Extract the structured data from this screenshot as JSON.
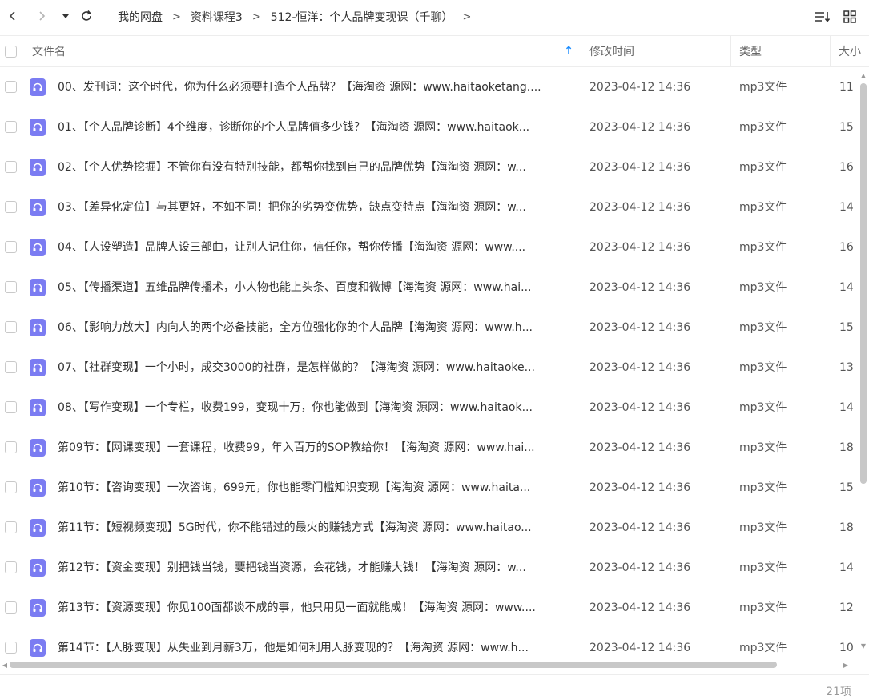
{
  "toolbar": {
    "back_icon": "chevron-left-icon",
    "forward_icon": "chevron-right-icon",
    "history_icon": "caret-down-icon",
    "refresh_icon": "refresh-icon",
    "sort_icon": "sort-icon",
    "view_icon": "grid-view-icon",
    "breadcrumbs": [
      "我的网盘",
      "资料课程3",
      "512-恒洋：个人品牌变现课（千聊）"
    ],
    "breadcrumb_separator": ">"
  },
  "header": {
    "col_name": "文件名",
    "col_modified": "修改时间",
    "col_type": "类型",
    "col_size": "大小",
    "sort_indicator": "↑",
    "sort_color": "#1a8cff"
  },
  "files": [
    {
      "name": "00、发刊词：这个时代，你为什么必须要打造个人品牌？【海淘资 源网：www.haitaoketang....",
      "modified": "2023-04-12 14:36",
      "type": "mp3文件",
      "size": "11"
    },
    {
      "name": "01、【个人品牌诊断】4个维度，诊断你的个人品牌值多少钱？【海淘资 源网：www.haitaok...",
      "modified": "2023-04-12 14:36",
      "type": "mp3文件",
      "size": "15"
    },
    {
      "name": "02、【个人优势挖掘】不管你有没有特别技能，都帮你找到自己的品牌优势【海淘资 源网：w...",
      "modified": "2023-04-12 14:36",
      "type": "mp3文件",
      "size": "16"
    },
    {
      "name": "03、【差异化定位】与其更好，不如不同！把你的劣势变优势，缺点变特点【海淘资 源网：w...",
      "modified": "2023-04-12 14:36",
      "type": "mp3文件",
      "size": "14"
    },
    {
      "name": "04、【人设塑造】品牌人设三部曲，让别人记住你，信任你，帮你传播【海淘资 源网：www....",
      "modified": "2023-04-12 14:36",
      "type": "mp3文件",
      "size": "16"
    },
    {
      "name": "05、【传播渠道】五维品牌传播术，小人物也能上头条、百度和微博【海淘资 源网：www.hai...",
      "modified": "2023-04-12 14:36",
      "type": "mp3文件",
      "size": "14"
    },
    {
      "name": "06、【影响力放大】内向人的两个必备技能，全方位强化你的个人品牌【海淘资 源网：www.h...",
      "modified": "2023-04-12 14:36",
      "type": "mp3文件",
      "size": "15"
    },
    {
      "name": "07、【社群变现】一个小时，成交3000的社群，是怎样做的？【海淘资 源网：www.haitaoke...",
      "modified": "2023-04-12 14:36",
      "type": "mp3文件",
      "size": "13"
    },
    {
      "name": "08、【写作变现】一个专栏，收费199，变现十万，你也能做到【海淘资 源网：www.haitaok...",
      "modified": "2023-04-12 14:36",
      "type": "mp3文件",
      "size": "14"
    },
    {
      "name": "第09节：【网课变现】一套课程，收费99，年入百万的SOP教给你！【海淘资 源网：www.hai...",
      "modified": "2023-04-12 14:36",
      "type": "mp3文件",
      "size": "18"
    },
    {
      "name": "第10节：【咨询变现】一次咨询，699元，你也能零门槛知识变现【海淘资 源网：www.haita...",
      "modified": "2023-04-12 14:36",
      "type": "mp3文件",
      "size": "15"
    },
    {
      "name": "第11节：【短视频变现】5G时代，你不能错过的最火的赚钱方式【海淘资 源网：www.haitao...",
      "modified": "2023-04-12 14:36",
      "type": "mp3文件",
      "size": "18"
    },
    {
      "name": "第12节：【资金变现】别把钱当钱，要把钱当资源，会花钱，才能赚大钱！【海淘资 源网：w...",
      "modified": "2023-04-12 14:36",
      "type": "mp3文件",
      "size": "14"
    },
    {
      "name": "第13节：【资源变现】你见100面都谈不成的事，他只用见一面就能成！【海淘资 源网：www....",
      "modified": "2023-04-12 14:36",
      "type": "mp3文件",
      "size": "12"
    },
    {
      "name": "第14节：【人脉变现】从失业到月薪3万，他是如何利用人脉变现的？【海淘资 源网：www.h...",
      "modified": "2023-04-12 14:36",
      "type": "mp3文件",
      "size": "10"
    }
  ],
  "file_icon": "audio-file-icon",
  "file_icon_color": "#7b7cf2",
  "footer": {
    "count": "21项"
  }
}
